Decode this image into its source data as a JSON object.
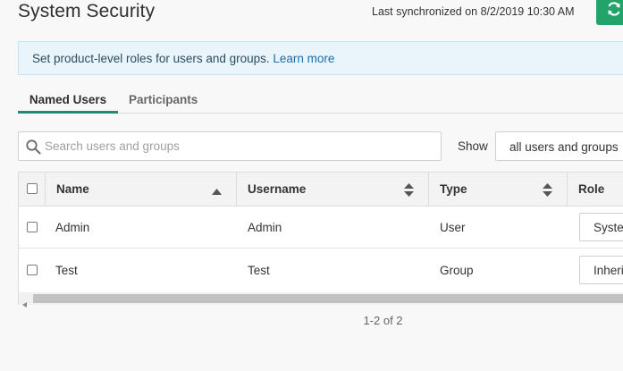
{
  "header": {
    "title": "System Security",
    "sync_text": "Last synchronized on 8/2/2019 10:30 AM",
    "sync_icon": "refresh-icon",
    "accent_color": "#22a36a"
  },
  "banner": {
    "text": "Set product-level roles for users and groups.",
    "link": "Learn more"
  },
  "tabs": [
    {
      "label": "Named Users",
      "active": true
    },
    {
      "label": "Participants",
      "active": false
    }
  ],
  "search": {
    "placeholder": "Search users and groups",
    "value": ""
  },
  "filter": {
    "label": "Show",
    "selected": "all users and groups"
  },
  "table": {
    "columns": [
      {
        "label": "Name",
        "sort": "ascending"
      },
      {
        "label": "Username",
        "sort": "none"
      },
      {
        "label": "Type",
        "sort": "none"
      },
      {
        "label": "Role"
      }
    ],
    "rows": [
      {
        "name": "Admin",
        "username": "Admin",
        "type": "User",
        "role": "System Administrator"
      },
      {
        "name": "Test",
        "username": "Test",
        "type": "Group",
        "role": "Inherited"
      }
    ]
  },
  "pagination": {
    "text": "1-2 of 2"
  }
}
